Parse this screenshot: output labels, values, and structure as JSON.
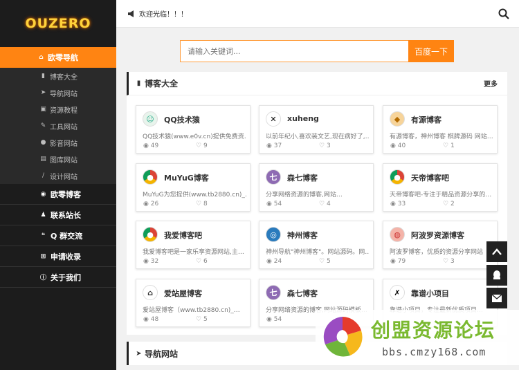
{
  "logo": "OUZERO",
  "sidebar": {
    "main": "欧零导航",
    "sub": [
      "博客大全",
      "导航网站",
      "资源教程",
      "工具网站",
      "影音网站",
      "图库网站",
      "设计网站"
    ],
    "items": [
      "欧零博客",
      "联系站长",
      "Q 群交流",
      "申请收录",
      "关于我们"
    ]
  },
  "topbar": {
    "welcome": "欢迎光临！！！"
  },
  "search": {
    "placeholder": "请输入关键词...",
    "button": "百度一下"
  },
  "section": {
    "title": "博客大全",
    "more": "更多"
  },
  "cards": [
    {
      "name": "QQ技术猿",
      "desc": "QQ技术猿(www.e0v.cn)提供免费资…",
      "views": "49",
      "likes": "9",
      "icon": "qq-tech-ape-icon"
    },
    {
      "name": "xuheng",
      "desc": "以前年纪小,喜欢装文艺,现在病好了,…",
      "views": "37",
      "likes": "3",
      "icon": "xuheng-icon"
    },
    {
      "name": "有源博客",
      "desc": "有源博客，神州博客 棋牌源码 网站…",
      "views": "40",
      "likes": "1",
      "icon": "youyuan-icon"
    },
    {
      "name": "MuYuG博客",
      "desc": "MuYuG为您提供(www.tb2880.cn)_…",
      "views": "26",
      "likes": "8",
      "icon": "chrome-icon"
    },
    {
      "name": "森七博客",
      "desc": "分享网络资源的博客,网站…",
      "views": "54",
      "likes": "4",
      "icon": "senqi-icon"
    },
    {
      "name": "天帝博客吧",
      "desc": "天帝博客吧-专注于精品资源分享的…",
      "views": "33",
      "likes": "2",
      "icon": "chrome-icon"
    },
    {
      "name": "我爱博客吧",
      "desc": "我爱博客吧是一家乐享资源网站,主…",
      "views": "32",
      "likes": "6",
      "icon": "chrome-icon"
    },
    {
      "name": "神州博客",
      "desc": "神州导航\"神州博客\"。网站源码。网…",
      "views": "24",
      "likes": "5",
      "icon": "shenzhou-icon"
    },
    {
      "name": "阿波罗资源博客",
      "desc": "阿波罗博客，优质的资源分享网站",
      "views": "79",
      "likes": "3",
      "icon": "apollo-icon"
    },
    {
      "name": "爱站屋博客",
      "desc": "爱站屋博客（www.tb2880.cn)_…",
      "views": "48",
      "likes": "5",
      "icon": "house-icon"
    },
    {
      "name": "森七博客",
      "desc": "分享网络资源的博客,网站源码模板…",
      "views": "54",
      "likes": "",
      "icon": "senqi-icon"
    },
    {
      "name": "靠谱小项目",
      "desc": "靠谱小项目，专注最新优质项目…",
      "views": "",
      "likes": "",
      "icon": "kaopu-icon"
    }
  ],
  "section2": {
    "title": "导航网站"
  },
  "watermark": {
    "title": "创盟资源论坛",
    "url": "bbs.cmzy168.com"
  },
  "colors": {
    "accent": "#ff8412",
    "sidebar": "#1c1c1c"
  }
}
